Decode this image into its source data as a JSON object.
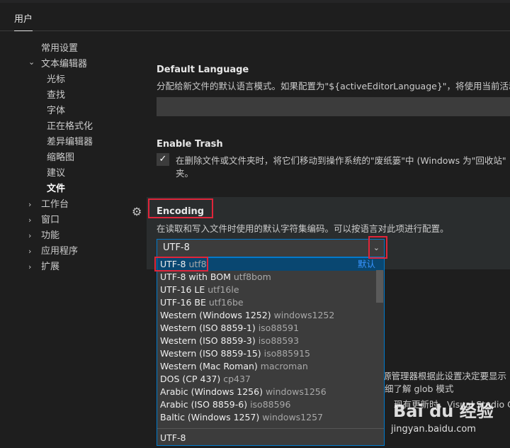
{
  "tabs": {
    "user": "用户"
  },
  "tree": {
    "items": [
      {
        "label": "常用设置",
        "chevron": "",
        "indent": 58
      },
      {
        "label": "文本编辑器",
        "chevron": "chevron-down",
        "indent": 58
      },
      {
        "label": "光标",
        "chevron": "",
        "indent": 66
      },
      {
        "label": "查找",
        "chevron": "",
        "indent": 66
      },
      {
        "label": "字体",
        "chevron": "",
        "indent": 66
      },
      {
        "label": "正在格式化",
        "chevron": "",
        "indent": 66
      },
      {
        "label": "差异编辑器",
        "chevron": "",
        "indent": 66
      },
      {
        "label": "缩略图",
        "chevron": "",
        "indent": 66
      },
      {
        "label": "建议",
        "chevron": "",
        "indent": 66
      },
      {
        "label": "文件",
        "chevron": "",
        "indent": 66,
        "active": true
      },
      {
        "label": "工作台",
        "chevron": "chevron-right",
        "indent": 58
      },
      {
        "label": "窗口",
        "chevron": "chevron-right",
        "indent": 58
      },
      {
        "label": "功能",
        "chevron": "chevron-right",
        "indent": 58
      },
      {
        "label": "应用程序",
        "chevron": "chevron-right",
        "indent": 58
      },
      {
        "label": "扩展",
        "chevron": "chevron-right",
        "indent": 58
      }
    ]
  },
  "default_language": {
    "title": "Default Language",
    "desc": "分配给新文件的默认语言模式。如果配置为\"${activeEditorLanguage}\"，将使用当前活动",
    "value": ""
  },
  "enable_trash": {
    "title": "Enable Trash",
    "desc_line1": "在删除文件或文件夹时，将它们移动到操作系统的\"废纸篓\"中 (Windows 为\"回收站\"",
    "desc_line2": "夹。",
    "checked": "✓"
  },
  "encoding": {
    "title": "Encoding",
    "desc": "在读取和写入文件时使用的默认字符集编码。可以按语言对此项进行配置。",
    "selected": "UTF-8",
    "default_tag": "默认",
    "options": [
      {
        "label": "UTF-8",
        "alias": "utf8",
        "selected": true
      },
      {
        "label": "UTF-8 with BOM",
        "alias": "utf8bom"
      },
      {
        "label": "UTF-16 LE",
        "alias": "utf16le"
      },
      {
        "label": "UTF-16 BE",
        "alias": "utf16be"
      },
      {
        "label": "Western (Windows 1252)",
        "alias": "windows1252"
      },
      {
        "label": "Western (ISO 8859-1)",
        "alias": "iso88591"
      },
      {
        "label": "Western (ISO 8859-3)",
        "alias": "iso88593"
      },
      {
        "label": "Western (ISO 8859-15)",
        "alias": "iso885915"
      },
      {
        "label": "Western (Mac Roman)",
        "alias": "macroman"
      },
      {
        "label": "DOS (CP 437)",
        "alias": "cp437"
      },
      {
        "label": "Arabic (Windows 1256)",
        "alias": "windows1256"
      },
      {
        "label": "Arabic (ISO 8859-6)",
        "alias": "iso88596"
      },
      {
        "label": "Baltic (Windows 1257)",
        "alias": "windows1257"
      }
    ],
    "footer_value": "UTF-8"
  },
  "behind_text": {
    "line1": "源管理器根据此设置决定要显示",
    "line2": "细了解 glob 模式",
    "line3": "现有更新时，Visual Studio Co"
  },
  "watermark": {
    "logo": "Bai du 经验",
    "url": "jingyan.baidu.com"
  },
  "colors": {
    "accent": "#007acc",
    "highlight_box": "#e0253a",
    "selection": "#094771"
  }
}
